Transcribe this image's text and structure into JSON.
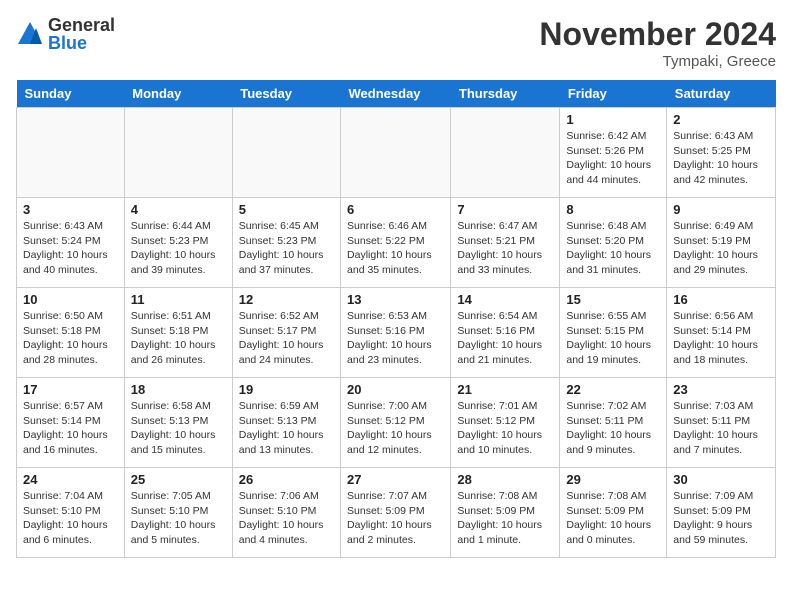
{
  "header": {
    "logo": {
      "general": "General",
      "blue": "Blue"
    },
    "month_year": "November 2024",
    "location": "Tympaki, Greece"
  },
  "days_of_week": [
    "Sunday",
    "Monday",
    "Tuesday",
    "Wednesday",
    "Thursday",
    "Friday",
    "Saturday"
  ],
  "weeks": [
    [
      {
        "day": "",
        "info": ""
      },
      {
        "day": "",
        "info": ""
      },
      {
        "day": "",
        "info": ""
      },
      {
        "day": "",
        "info": ""
      },
      {
        "day": "",
        "info": ""
      },
      {
        "day": "1",
        "info": "Sunrise: 6:42 AM\nSunset: 5:26 PM\nDaylight: 10 hours and 44 minutes."
      },
      {
        "day": "2",
        "info": "Sunrise: 6:43 AM\nSunset: 5:25 PM\nDaylight: 10 hours and 42 minutes."
      }
    ],
    [
      {
        "day": "3",
        "info": "Sunrise: 6:43 AM\nSunset: 5:24 PM\nDaylight: 10 hours and 40 minutes."
      },
      {
        "day": "4",
        "info": "Sunrise: 6:44 AM\nSunset: 5:23 PM\nDaylight: 10 hours and 39 minutes."
      },
      {
        "day": "5",
        "info": "Sunrise: 6:45 AM\nSunset: 5:23 PM\nDaylight: 10 hours and 37 minutes."
      },
      {
        "day": "6",
        "info": "Sunrise: 6:46 AM\nSunset: 5:22 PM\nDaylight: 10 hours and 35 minutes."
      },
      {
        "day": "7",
        "info": "Sunrise: 6:47 AM\nSunset: 5:21 PM\nDaylight: 10 hours and 33 minutes."
      },
      {
        "day": "8",
        "info": "Sunrise: 6:48 AM\nSunset: 5:20 PM\nDaylight: 10 hours and 31 minutes."
      },
      {
        "day": "9",
        "info": "Sunrise: 6:49 AM\nSunset: 5:19 PM\nDaylight: 10 hours and 29 minutes."
      }
    ],
    [
      {
        "day": "10",
        "info": "Sunrise: 6:50 AM\nSunset: 5:18 PM\nDaylight: 10 hours and 28 minutes."
      },
      {
        "day": "11",
        "info": "Sunrise: 6:51 AM\nSunset: 5:18 PM\nDaylight: 10 hours and 26 minutes."
      },
      {
        "day": "12",
        "info": "Sunrise: 6:52 AM\nSunset: 5:17 PM\nDaylight: 10 hours and 24 minutes."
      },
      {
        "day": "13",
        "info": "Sunrise: 6:53 AM\nSunset: 5:16 PM\nDaylight: 10 hours and 23 minutes."
      },
      {
        "day": "14",
        "info": "Sunrise: 6:54 AM\nSunset: 5:16 PM\nDaylight: 10 hours and 21 minutes."
      },
      {
        "day": "15",
        "info": "Sunrise: 6:55 AM\nSunset: 5:15 PM\nDaylight: 10 hours and 19 minutes."
      },
      {
        "day": "16",
        "info": "Sunrise: 6:56 AM\nSunset: 5:14 PM\nDaylight: 10 hours and 18 minutes."
      }
    ],
    [
      {
        "day": "17",
        "info": "Sunrise: 6:57 AM\nSunset: 5:14 PM\nDaylight: 10 hours and 16 minutes."
      },
      {
        "day": "18",
        "info": "Sunrise: 6:58 AM\nSunset: 5:13 PM\nDaylight: 10 hours and 15 minutes."
      },
      {
        "day": "19",
        "info": "Sunrise: 6:59 AM\nSunset: 5:13 PM\nDaylight: 10 hours and 13 minutes."
      },
      {
        "day": "20",
        "info": "Sunrise: 7:00 AM\nSunset: 5:12 PM\nDaylight: 10 hours and 12 minutes."
      },
      {
        "day": "21",
        "info": "Sunrise: 7:01 AM\nSunset: 5:12 PM\nDaylight: 10 hours and 10 minutes."
      },
      {
        "day": "22",
        "info": "Sunrise: 7:02 AM\nSunset: 5:11 PM\nDaylight: 10 hours and 9 minutes."
      },
      {
        "day": "23",
        "info": "Sunrise: 7:03 AM\nSunset: 5:11 PM\nDaylight: 10 hours and 7 minutes."
      }
    ],
    [
      {
        "day": "24",
        "info": "Sunrise: 7:04 AM\nSunset: 5:10 PM\nDaylight: 10 hours and 6 minutes."
      },
      {
        "day": "25",
        "info": "Sunrise: 7:05 AM\nSunset: 5:10 PM\nDaylight: 10 hours and 5 minutes."
      },
      {
        "day": "26",
        "info": "Sunrise: 7:06 AM\nSunset: 5:10 PM\nDaylight: 10 hours and 4 minutes."
      },
      {
        "day": "27",
        "info": "Sunrise: 7:07 AM\nSunset: 5:09 PM\nDaylight: 10 hours and 2 minutes."
      },
      {
        "day": "28",
        "info": "Sunrise: 7:08 AM\nSunset: 5:09 PM\nDaylight: 10 hours and 1 minute."
      },
      {
        "day": "29",
        "info": "Sunrise: 7:08 AM\nSunset: 5:09 PM\nDaylight: 10 hours and 0 minutes."
      },
      {
        "day": "30",
        "info": "Sunrise: 7:09 AM\nSunset: 5:09 PM\nDaylight: 9 hours and 59 minutes."
      }
    ]
  ]
}
